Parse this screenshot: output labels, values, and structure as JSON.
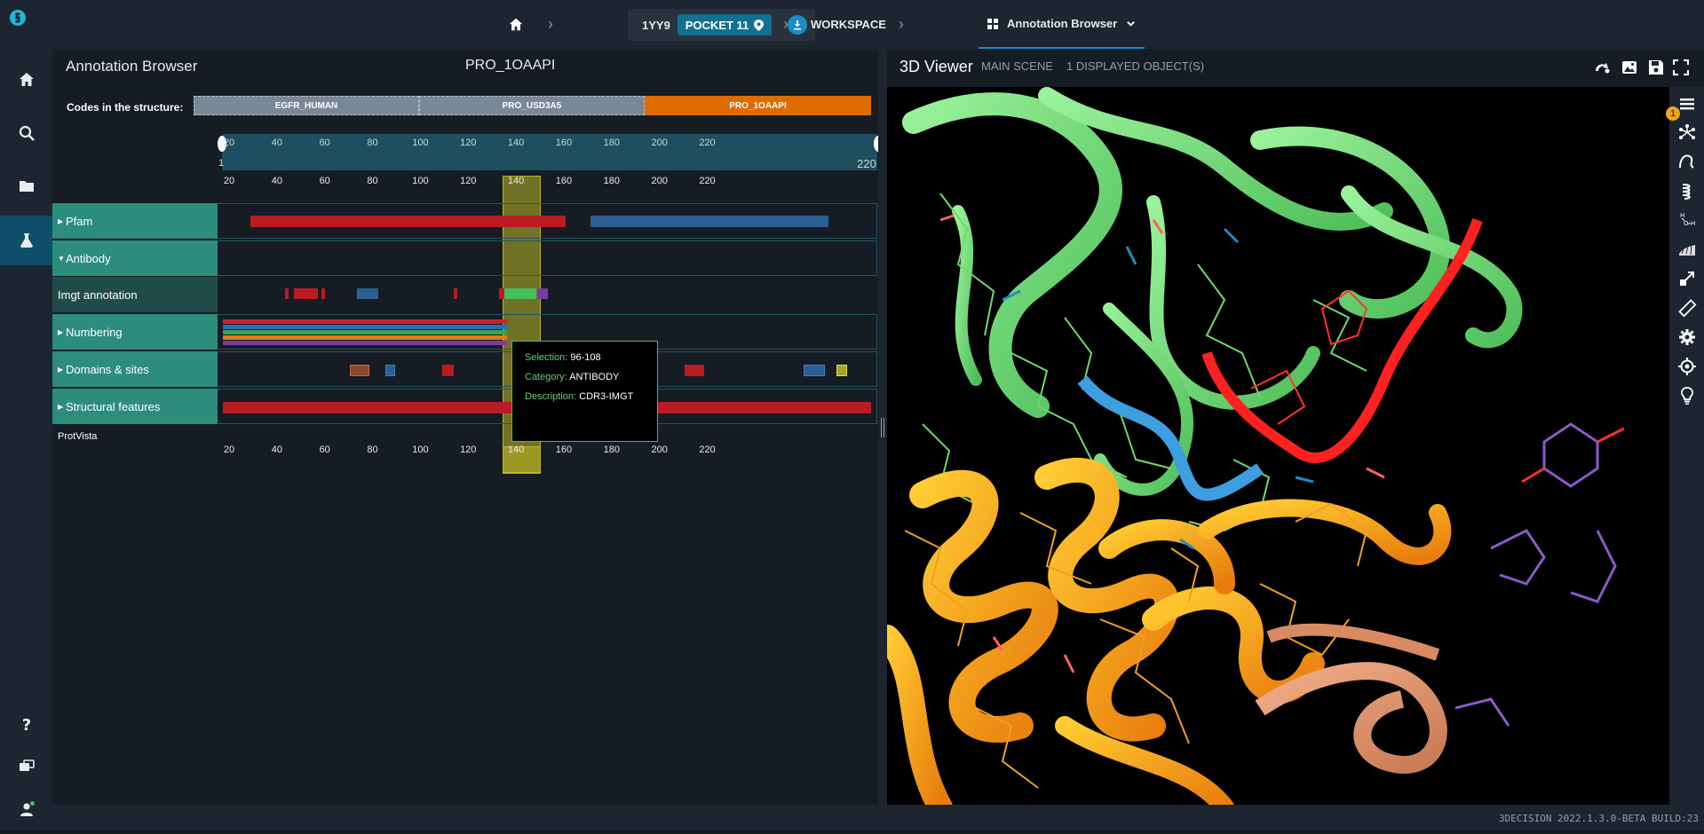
{
  "breadcrumb": {
    "structure_id": "1YY9",
    "pocket_label": "POCKET 11",
    "workspace_label": "WORKSPACE",
    "view_label": "Annotation Browser"
  },
  "annotation_browser": {
    "title": "Annotation Browser",
    "protein_title": "PRO_1OAAPI",
    "codes_label": "Codes in the structure:",
    "codes": [
      {
        "label": "EGFR_HUMAN",
        "color": "#7a8796"
      },
      {
        "label": "PRO_USD3A5",
        "color": "#7a8796"
      },
      {
        "label": "PRO_1OAAPI",
        "color": "#dd6d03"
      }
    ],
    "navigation": {
      "ticks": [
        "20",
        "40",
        "60",
        "80",
        "100",
        "120",
        "140",
        "160",
        "180",
        "200",
        "220"
      ],
      "start": "1",
      "end": "220"
    },
    "axis_ticks": [
      "20",
      "40",
      "60",
      "80",
      "100",
      "120",
      "140",
      "160",
      "180",
      "200",
      "220"
    ],
    "tracks": [
      {
        "label": "Pfam",
        "expanded": false
      },
      {
        "label": "Antibody",
        "expanded": true
      },
      {
        "label": "Imgt annotation",
        "sub": true
      },
      {
        "label": "Numbering",
        "expanded": false
      },
      {
        "label": "Domains & sites",
        "expanded": false
      },
      {
        "label": "Structural features",
        "expanded": false
      }
    ],
    "footer_label": "ProtVista",
    "selection": {
      "start": 96,
      "end": 108
    },
    "tooltip": {
      "selection_key": "Selection:",
      "selection_value": "96-108",
      "category_key": "Category:",
      "category_value": "ANTIBODY",
      "description_key": "Description:",
      "description_value": "CDR3-IMGT"
    }
  },
  "viewer": {
    "title": "3D Viewer",
    "scene_label": "MAIN SCENE",
    "displayed_label": "1 DISPLAYED OBJECT(S)",
    "notification_count": "1"
  },
  "footer": {
    "build": "3DECISION 2022.1.3.0-BETA BUILD:23"
  },
  "colors": {
    "accent": "#14708f",
    "track_label": "#2c8d7d",
    "highlight": "#bab52a",
    "pfam_red": "#b91c23",
    "pfam_blue": "#2c5f94",
    "selected_code": "#dd6d03"
  }
}
